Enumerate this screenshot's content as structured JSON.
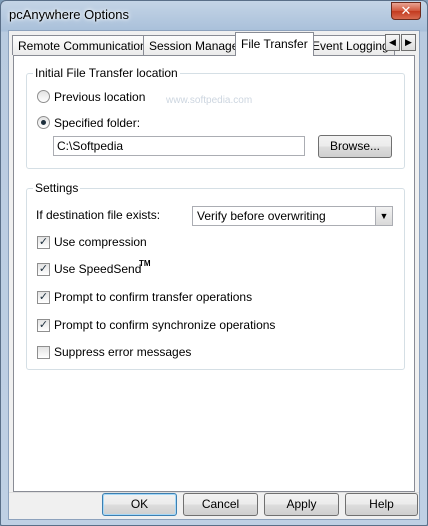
{
  "window": {
    "title": "pcAnywhere Options",
    "close_glyph": "✕"
  },
  "tabs": [
    {
      "label": "Remote Communications",
      "active": false
    },
    {
      "label": "Session Manager",
      "active": false
    },
    {
      "label": "File Transfer",
      "active": true
    },
    {
      "label": "Event Logging",
      "active": false
    }
  ],
  "tab_scroll": {
    "left_glyph": "◀",
    "right_glyph": "▶"
  },
  "watermark": "www.softpedia.com",
  "location_group": {
    "title": "Initial File Transfer location",
    "previous_label": "Previous location",
    "previous_checked": false,
    "specified_label": "Specified folder:",
    "specified_checked": true,
    "folder_value": "C:\\Softpedia",
    "browse_label": "Browse..."
  },
  "settings_group": {
    "title": "Settings",
    "dest_exists_label": "If destination file exists:",
    "dest_exists_value": "Verify before overwriting",
    "dropdown_glyph": "▼",
    "check_glyph": "✓",
    "options": [
      {
        "label": "Use compression",
        "checked": true
      },
      {
        "label": "Use SpeedSend",
        "checked": true,
        "suffix": "TM"
      },
      {
        "label": "Prompt to confirm transfer operations",
        "checked": true
      },
      {
        "label": "Prompt to confirm synchronize operations",
        "checked": true
      },
      {
        "label": "Suppress error messages",
        "checked": false
      }
    ]
  },
  "footer": {
    "ok_label": "OK",
    "cancel_label": "Cancel",
    "apply_label": "Apply",
    "help_label": "Help"
  }
}
